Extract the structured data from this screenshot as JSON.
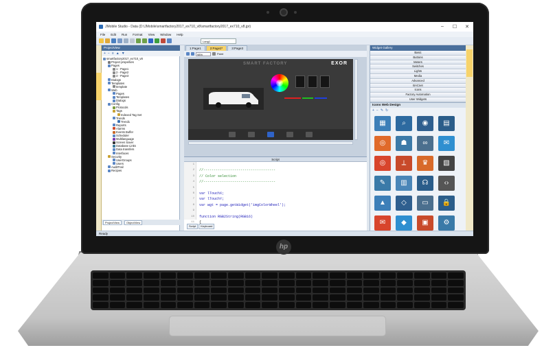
{
  "window": {
    "title": "JMobile Studio - Data (D:\\JMobile\\smartfactory2017_ex710_v8\\smartfactory2017_ex710_v8.jpr)",
    "minimize": "–",
    "maximize": "☐",
    "close": "✕"
  },
  "menu": [
    "File",
    "Edit",
    "Run",
    "Format",
    "View",
    "Window",
    "Help"
  ],
  "toolbar": {
    "language": "Lang1"
  },
  "left_panel": {
    "header": "ProjectView",
    "tree": [
      {
        "label": "smartfactory2017_ex710_v8",
        "depth": 0,
        "color": "#6b8fc2"
      },
      {
        "label": "Project properties",
        "depth": 1,
        "color": "#7a7a7a"
      },
      {
        "label": "Pages",
        "depth": 1,
        "color": "#5a86c5"
      },
      {
        "label": "1 - Page1",
        "depth": 2,
        "color": "#888"
      },
      {
        "label": "2 - Page2",
        "depth": 2,
        "color": "#888"
      },
      {
        "label": "3 - Page3",
        "depth": 2,
        "color": "#888"
      },
      {
        "label": "Dialogs",
        "depth": 1,
        "color": "#5a86c5"
      },
      {
        "label": "Templates",
        "depth": 1,
        "color": "#5a86c5"
      },
      {
        "label": "template",
        "depth": 2,
        "color": "#888"
      },
      {
        "label": "Web",
        "depth": 1,
        "color": "#5a86c5"
      },
      {
        "label": "Pages",
        "depth": 2,
        "color": "#5a86c5"
      },
      {
        "label": "Templates",
        "depth": 2,
        "color": "#5a86c5"
      },
      {
        "label": "Dialogs",
        "depth": 2,
        "color": "#5a86c5"
      },
      {
        "label": "Config",
        "depth": 1,
        "color": "#5a86c5"
      },
      {
        "label": "Protocols",
        "depth": 2,
        "color": "#7a9a3a"
      },
      {
        "label": "Tags",
        "depth": 2,
        "color": "#c9a233"
      },
      {
        "label": "Indexed Tag Set",
        "depth": 3,
        "color": "#c9a233"
      },
      {
        "label": "Trends",
        "depth": 2,
        "color": "#5a86c5"
      },
      {
        "label": "Trend1",
        "depth": 3,
        "color": "#3a6fb0"
      },
      {
        "label": "Reports",
        "depth": 2,
        "color": "#5a86c5"
      },
      {
        "label": "Alarms",
        "depth": 2,
        "color": "#d04a2a"
      },
      {
        "label": "Events Buffer",
        "depth": 2,
        "color": "#c86a2a"
      },
      {
        "label": "Scheduler",
        "depth": 2,
        "color": "#5a86c5"
      },
      {
        "label": "Multilanguage",
        "depth": 2,
        "color": "#7a3ab0"
      },
      {
        "label": "Screen Saver",
        "depth": 2,
        "color": "#333"
      },
      {
        "label": "Database Links",
        "depth": 2,
        "color": "#3a7a9a"
      },
      {
        "label": "Data transfers",
        "depth": 2,
        "color": "#5a86c5"
      },
      {
        "label": "Interfaces",
        "depth": 2,
        "color": "#5a86c5"
      },
      {
        "label": "Security",
        "depth": 1,
        "color": "#c9a233"
      },
      {
        "label": "UserGroups",
        "depth": 2,
        "color": "#5a86c5"
      },
      {
        "label": "Users",
        "depth": 2,
        "color": "#5a86c5"
      },
      {
        "label": "AuditTrail",
        "depth": 1,
        "color": "#5a86c5"
      },
      {
        "label": "Recipes",
        "depth": 1,
        "color": "#5a86c5"
      }
    ],
    "footer_tabs": [
      "ProjectView",
      "ObjectView"
    ]
  },
  "editor": {
    "tabs": [
      "1:Page1",
      "2:Page2*",
      "3:Page3"
    ],
    "active_tab": 1,
    "zoom": "98%",
    "paint_label": "Paint",
    "canvas": {
      "title": "SMART FACTORY",
      "brand": "EXOR"
    }
  },
  "script": {
    "header": "Script",
    "line_numbers": [
      "1",
      "2",
      "3",
      "4",
      "5",
      "6",
      "7",
      "8",
      "9",
      "10",
      "11"
    ],
    "lines": [
      {
        "text": "",
        "cls": ""
      },
      {
        "text": "//-----------------------------------",
        "cls": "comment"
      },
      {
        "text": "// Color selection",
        "cls": "comment"
      },
      {
        "text": "//-----------------------------------",
        "cls": "comment"
      },
      {
        "text": "",
        "cls": ""
      },
      {
        "text": "var lTouchX;",
        "cls": "kw"
      },
      {
        "text": "var lTouchY;",
        "cls": "kw"
      },
      {
        "text": "var wgt = page.getWidget('imgColorWheel');",
        "cls": "kw"
      },
      {
        "text": "",
        "cls": ""
      },
      {
        "text": "function RGB2String(RGB16)",
        "cls": "kw"
      },
      {
        "text": "{",
        "cls": ""
      }
    ],
    "tabs": [
      "Script",
      "Keyboard"
    ]
  },
  "right_panel": {
    "header": "Widget Gallery",
    "categories": [
      "Basic",
      "Buttons",
      "Meters",
      "Switches",
      "Lights",
      "Media",
      "Advanced",
      "BACnet",
      "Icons",
      "Factory Automation",
      "User Widgets"
    ],
    "section": "Icons Web Design",
    "icons": [
      {
        "name": "chart-icon",
        "bg": "#3d7fb8",
        "glyph": "▦"
      },
      {
        "name": "magnifier-icon",
        "bg": "#2d6aa0",
        "glyph": "⌕"
      },
      {
        "name": "picture-frame-icon",
        "bg": "#2f5f8f",
        "glyph": "◉"
      },
      {
        "name": "clipboard-icon",
        "bg": "#2b5d8a",
        "glyph": "▤"
      },
      {
        "name": "eye-icon",
        "bg": "#e06a2a",
        "glyph": "◎"
      },
      {
        "name": "org-chart-icon",
        "bg": "#3c7aa8",
        "glyph": "☗"
      },
      {
        "name": "link-icon",
        "bg": "#4b6f8e",
        "glyph": "∞"
      },
      {
        "name": "chat-icon",
        "bg": "#2f8fd0",
        "glyph": "✉"
      },
      {
        "name": "target-icon",
        "bg": "#d8452c",
        "glyph": "◎"
      },
      {
        "name": "compass-icon",
        "bg": "#c84a2a",
        "glyph": "⟂"
      },
      {
        "name": "trophy-icon",
        "bg": "#d86a2a",
        "glyph": "♛"
      },
      {
        "name": "clapper-icon",
        "bg": "#444",
        "glyph": "▧"
      },
      {
        "name": "pencil-icon",
        "bg": "#3a7aa8",
        "glyph": "✎"
      },
      {
        "name": "layout-icon",
        "bg": "#4a86b8",
        "glyph": "▥"
      },
      {
        "name": "headset-icon",
        "bg": "#2b5d8a",
        "glyph": "☊"
      },
      {
        "name": "code-icon",
        "bg": "#555",
        "glyph": "‹›"
      },
      {
        "name": "image-icon",
        "bg": "#3d7fb8",
        "glyph": "▲"
      },
      {
        "name": "vector-icon",
        "bg": "#2f5f8f",
        "glyph": "◇"
      },
      {
        "name": "browser-icon",
        "bg": "#4b6f8e",
        "glyph": "▭"
      },
      {
        "name": "lock-icon",
        "bg": "#2b5d8a",
        "glyph": "🔒"
      },
      {
        "name": "envelope-icon",
        "bg": "#d8452c",
        "glyph": "✉"
      },
      {
        "name": "diamond-icon",
        "bg": "#2f8fd0",
        "glyph": "◆"
      },
      {
        "name": "briefcase-icon",
        "bg": "#c84a2a",
        "glyph": "▣"
      },
      {
        "name": "gear-box-icon",
        "bg": "#3a7aa8",
        "glyph": "⚙"
      }
    ]
  },
  "status": {
    "text": "Ready"
  }
}
